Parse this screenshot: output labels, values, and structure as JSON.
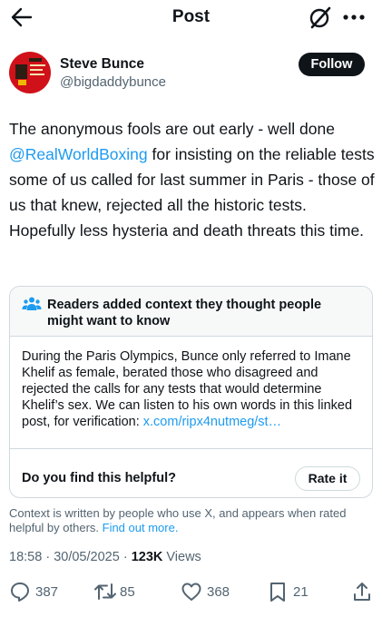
{
  "header": {
    "title": "Post",
    "back_icon": "arrow-left-icon",
    "grok_icon": "grok-icon",
    "more_icon": "more-horizontal-icon"
  },
  "author": {
    "name": "Steve Bunce",
    "handle": "@bigdaddybunce",
    "follow_label": "Follow"
  },
  "tweet": {
    "text_before": "The anonymous fools are out early - well done ",
    "mention": "@RealWorldBoxing",
    "text_after": " for insisting on the reliable tests some of us called for last summer in Paris - those of us that knew, rejected all the historic tests. Hopefully less hysteria and death threats this time."
  },
  "community_note": {
    "title": "Readers added context they thought people might want to know",
    "body": "During the Paris Olympics, Bunce only referred to Imane Khelif as female, berated those who disagreed and rejected the calls for any tests that would determine Khelif’s sex. We can listen to his own words in this linked post, for verification: ",
    "link": "x.com/ripx4nutmeg/st…",
    "helpful_question": "Do you find this helpful?",
    "rate_label": "Rate it",
    "icon": "people-icon"
  },
  "context_info": {
    "text": "Context is written by people who use X, and appears when rated helpful by others. ",
    "link": "Find out more."
  },
  "meta": {
    "time": "18:58",
    "separator": "·",
    "date": "30/05/2025",
    "views_count": "123K",
    "views_label": "Views"
  },
  "actions": {
    "replies": "387",
    "reposts": "85",
    "likes": "368",
    "bookmarks": "21"
  },
  "colors": {
    "accent": "#1d9bf0",
    "text": "#0f1419",
    "secondary": "#536471",
    "border": "#cfd9de"
  }
}
